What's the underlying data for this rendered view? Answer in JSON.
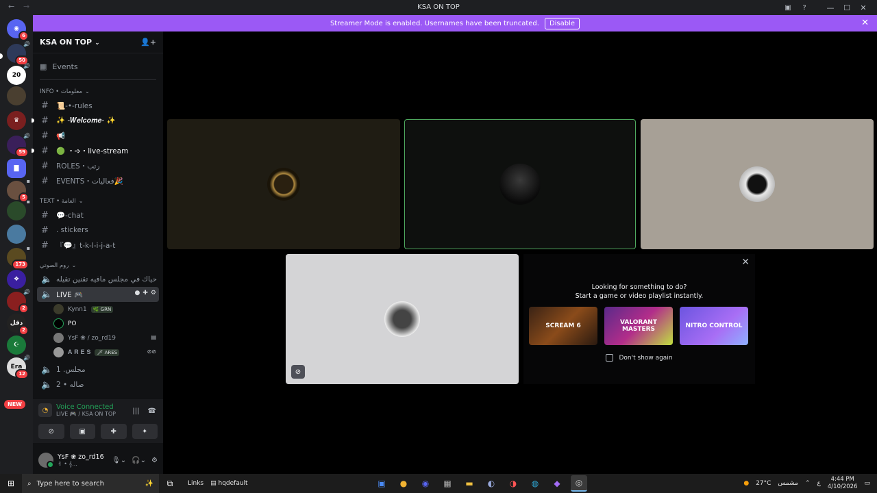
{
  "window": {
    "title": "KSA ON TOP",
    "back_icon": "arrow-left-icon",
    "fwd_icon": "arrow-right-icon"
  },
  "rail": {
    "badges": [
      "6",
      "50",
      "",
      "",
      "",
      "59",
      "",
      "5",
      "",
      "",
      "173",
      "",
      "2",
      "2",
      "",
      "12"
    ],
    "new_label": "NEW",
    "srv_labels": [
      "20",
      "دقل",
      "Era"
    ]
  },
  "banner": {
    "text": "Streamer Mode is enabled. Usernames have been truncated.",
    "button": "Disable"
  },
  "server": {
    "name": "KSA ON TOP",
    "events_label": "Events"
  },
  "categories": {
    "info": "INFO • معلومات",
    "text": "TEXT • العامة",
    "voice": "روم الصوتي"
  },
  "channels": {
    "info": [
      {
        "label": "📜-•-rules"
      },
      {
        "label": "✨ -𝑾𝒆𝒍𝒄𝒐𝒎𝒆- ✨"
      },
      {
        "label": "📢"
      },
      {
        "label": "🟢 ・➩・live-stream"
      },
      {
        "label": "ROLES・رتب"
      },
      {
        "label": "EVENTS・فعاليات🎉"
      }
    ],
    "text": [
      {
        "label": "💬-chat"
      },
      {
        "label": ". stickers"
      },
      {
        "label": "『💬』t-k-l-i-j-a-t"
      }
    ],
    "voice": [
      {
        "label": "حياك في مجلس مافيه تقنين تقيله"
      },
      {
        "label": "LIVE 🎮"
      },
      {
        "label": "مجلس. 1"
      },
      {
        "label": "صاله • 2"
      }
    ]
  },
  "voice_users": [
    {
      "name": "Kynn1",
      "tag": "🌿 GRN"
    },
    {
      "name": "PO",
      "tag": ""
    },
    {
      "name": "YsF ❀ / zo_rd19",
      "tag": ""
    },
    {
      "name": "𝐀 𝐑 𝐄 𝐒",
      "tag": "🗡 ARES"
    }
  ],
  "voice_panel": {
    "title": "Voice Connected",
    "subtitle": "LIVE 🎮 / KSA ON TOP"
  },
  "user": {
    "name": "YsF ❀ zo_rd16",
    "status": "✌ • 𝄞..."
  },
  "activity": {
    "line1": "Looking for something to do?",
    "line2": "Start a game or video playlist instantly.",
    "cards": [
      "SCREAM 6",
      "VALORANT MASTERS",
      "NITRO CONTROL"
    ],
    "dont_show": "Don't show again"
  },
  "taskbar": {
    "search_placeholder": "Type here to search",
    "links": "Links",
    "app_label": "hqdefault",
    "weather": "27°C",
    "weather_text": "مشمس",
    "lang": "ع",
    "time": "4:44 PM",
    "date": "4/10/2026"
  },
  "colors": {
    "banner": "#9b59f5",
    "connected": "#23a55a",
    "speaking_border": "#4ea85e"
  }
}
